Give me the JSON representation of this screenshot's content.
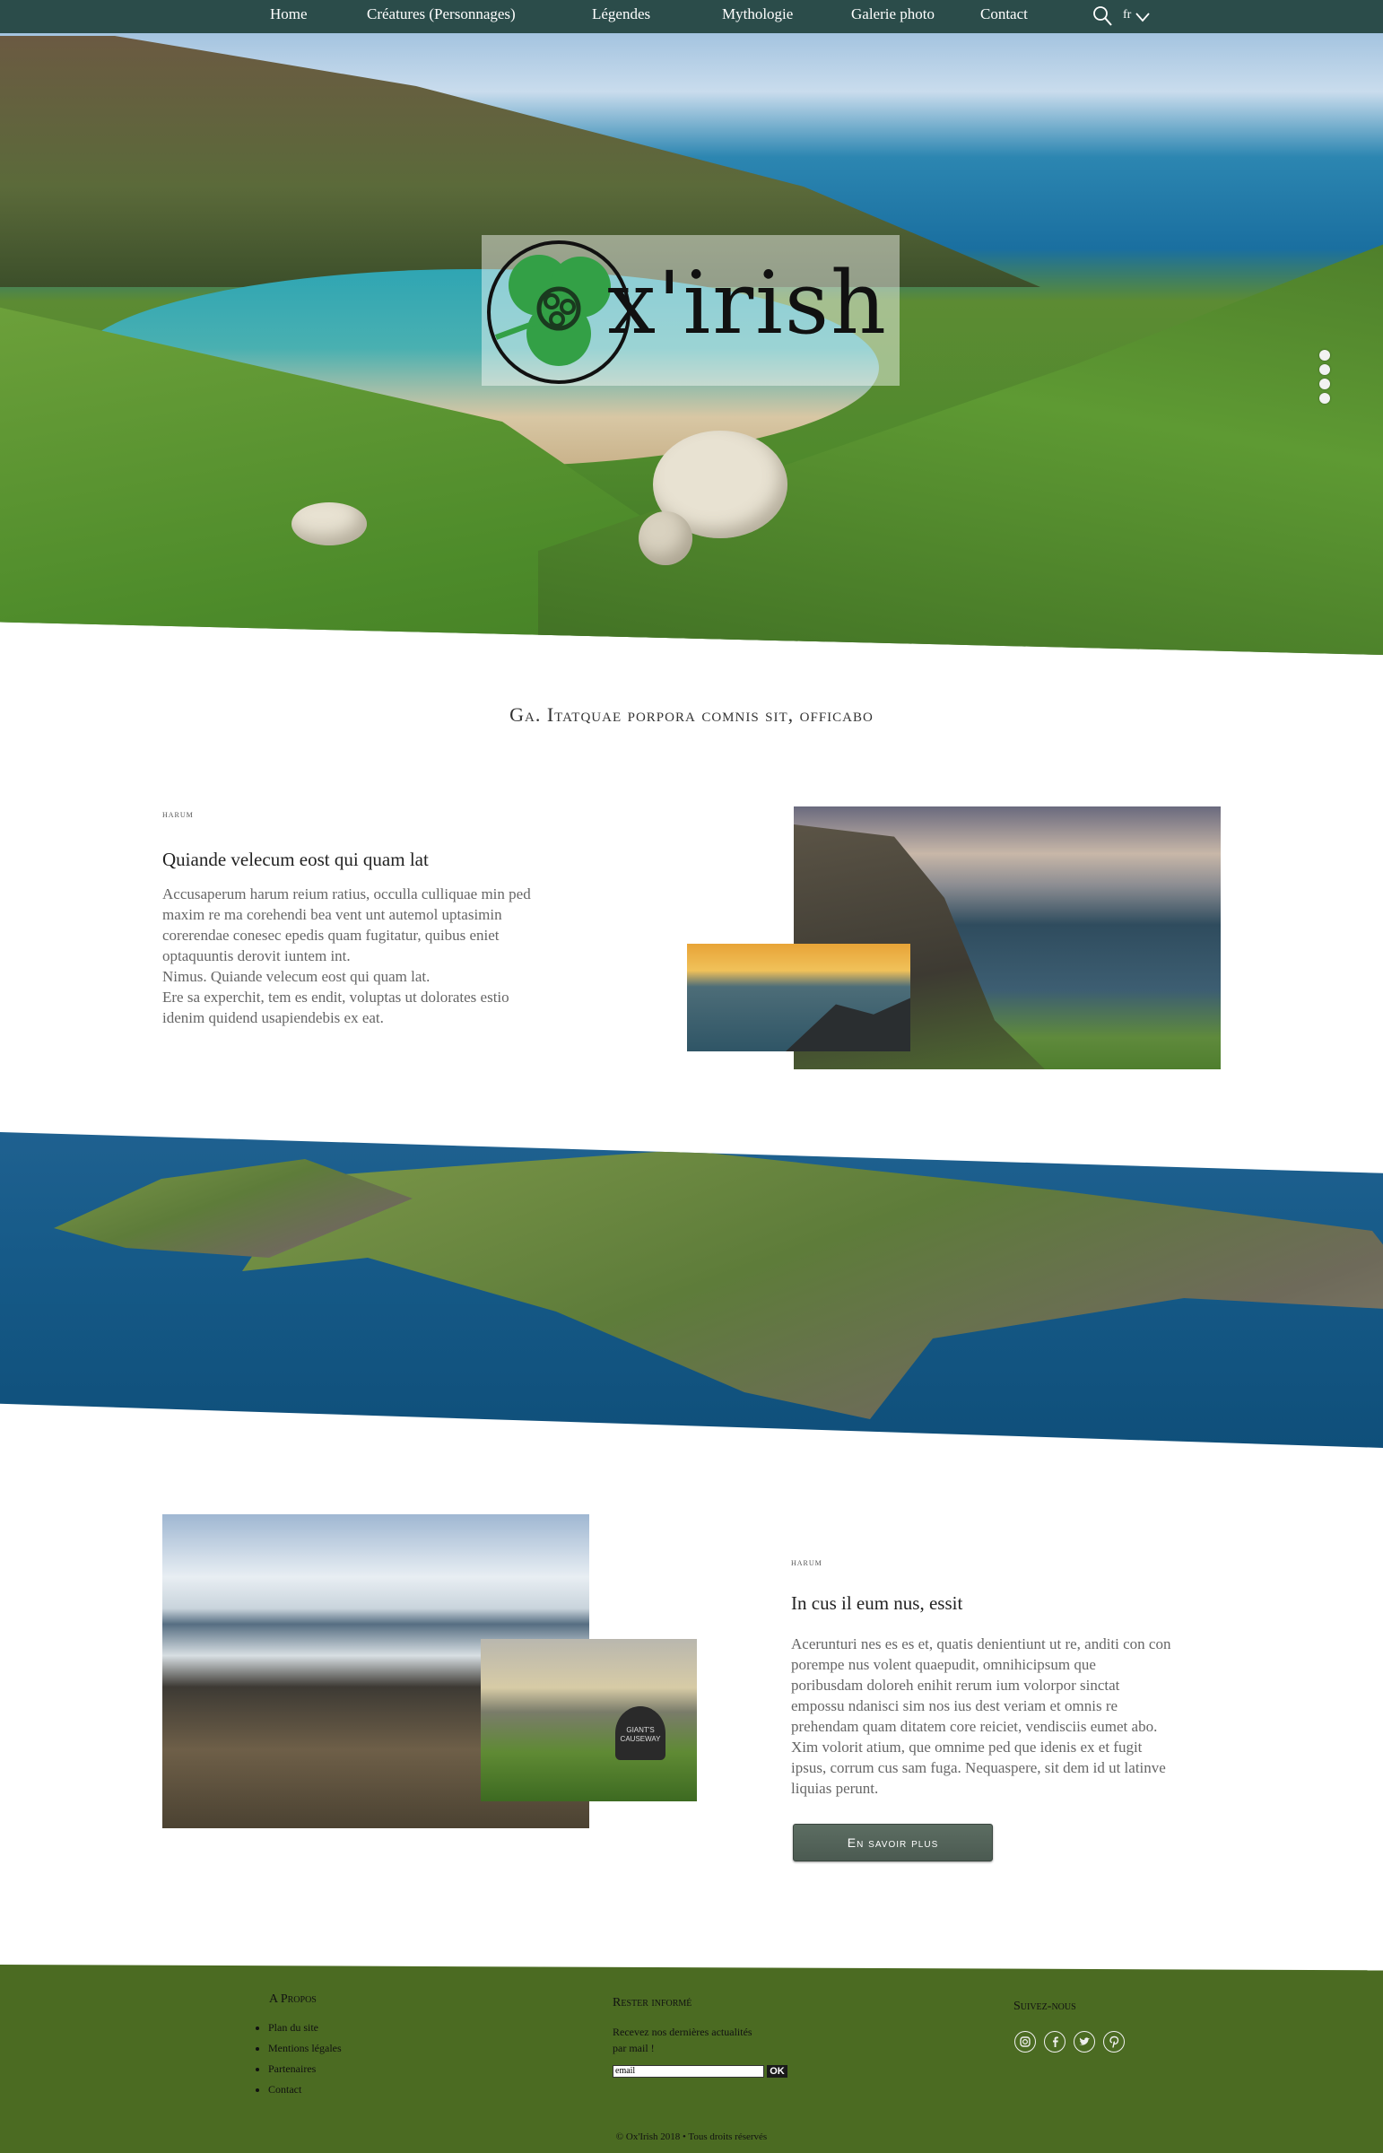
{
  "nav": {
    "items": [
      "Home",
      "Créatures (Personnages)",
      "Légendes",
      "Mythologie",
      "Galerie photo",
      "Contact"
    ],
    "search_icon": "search-icon",
    "language": "fr",
    "language_icon": "chevron-down-icon"
  },
  "hero": {
    "logo_text": "x'irish",
    "logo_icon": "shamrock-triskele-icon",
    "slider_dots": 4,
    "active_dot": 1
  },
  "intro": {
    "tagline": "Ga. Itatquae porpora comnis sit, officabo"
  },
  "section1": {
    "kicker": "harum",
    "title": "Quiande velecum eost qui quam lat",
    "text": "Accusaperum harum reium ratius, occulla culliquae min ped\nmaxim re ma corehendi bea vent unt autemol uptasimin\ncorerendae conesec epedis quam fugitatur, quibus eniet\noptaquuntis derovit iuntem int.\nNimus. Quiande velecum eost qui quam lat.\nEre sa experchit, tem es endit, voluptas ut dolorates estio\nidenim quidend usapiendebis ex eat."
  },
  "section2": {
    "kicker": "harum",
    "title": "In cus il eum nus, essit",
    "text": "Acerunturi nes es es et, quatis denientiunt ut re, anditi con con\nporempe nus volent quaepudit, omnihicipsum que\nporibusdam doloreh enihit rerum ium volorpor sinctat\nempossu ndanisci sim nos ius dest veriam et omnis re\nprehendam quam ditatem core reiciet, vendisciis eumet abo.\nXim volorit atium, que omnime ped que idenis ex et fugit\nipsus, corrum cus sam fuga. Nequaspere, sit dem id ut latinve\nliquias perunt.",
    "button": "En savoir plus",
    "sign_text": "GIANT'S CAUSEWAY"
  },
  "footer": {
    "about_title": "A Propos",
    "about_links": [
      "Plan du site",
      "Mentions légales",
      "Partenaires",
      "Contact"
    ],
    "newsletter_title": "Rester informé",
    "newsletter_text": "Recevez nos dernières actualités\npar mail !",
    "email_placeholder": "email",
    "ok_label": "OK",
    "social_title": "Suivez-nous",
    "social_icons": [
      "instagram-icon",
      "facebook-icon",
      "twitter-icon",
      "pinterest-icon"
    ],
    "copyright": "© Ox'Irish 2018 • Tous droits réservés"
  },
  "colors": {
    "nav_bg": "#2b4c4a",
    "footer_bg": "#4b6b22",
    "button_bg": "#56665b",
    "logo_green": "#2e9a3c"
  }
}
